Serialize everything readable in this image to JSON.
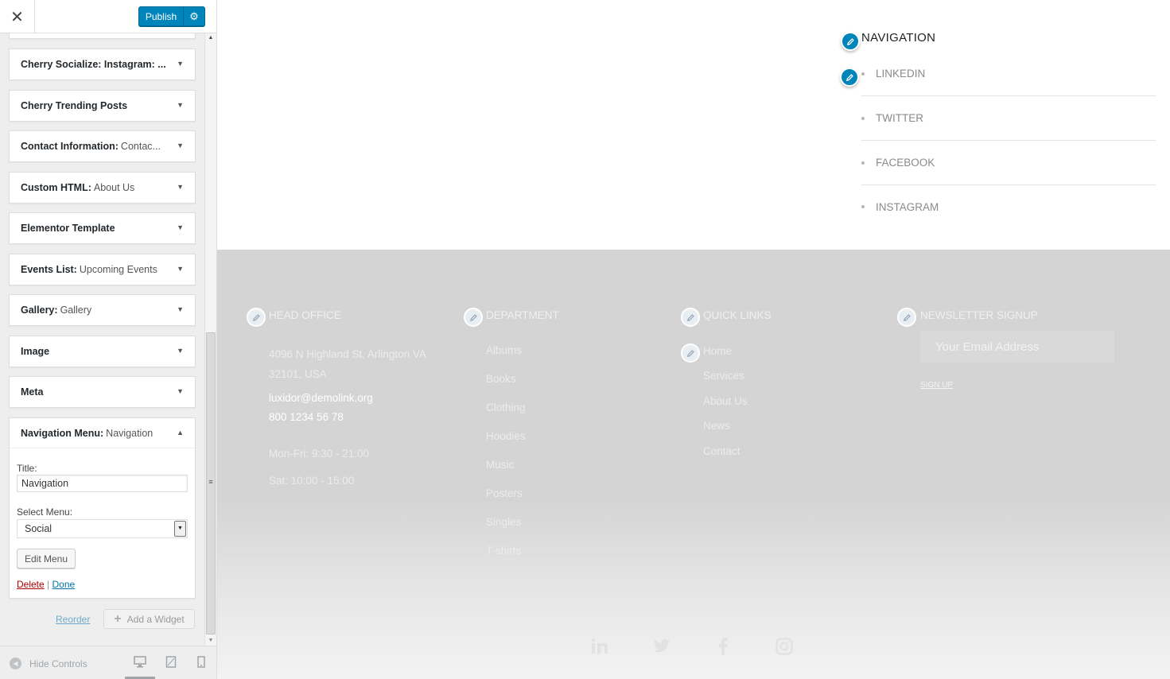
{
  "customizer": {
    "close_icon": "✕",
    "publish_label": "Publish",
    "settings_icon": "⚙",
    "widgets": [
      {
        "name": "Cherry Socialize: Instagram: ...",
        "sub": ""
      },
      {
        "name": "Cherry Trending Posts",
        "sub": ""
      },
      {
        "name": "Contact Information:",
        "sub": "Contac..."
      },
      {
        "name": "Custom HTML:",
        "sub": "About Us"
      },
      {
        "name": "Elementor Template",
        "sub": ""
      },
      {
        "name": "Events List:",
        "sub": "Upcoming Events"
      },
      {
        "name": "Gallery:",
        "sub": "Gallery"
      },
      {
        "name": "Image",
        "sub": ""
      },
      {
        "name": "Meta",
        "sub": ""
      }
    ],
    "open_widget": {
      "name": "Navigation Menu:",
      "sub": "Navigation",
      "title_label": "Title:",
      "title_value": "Navigation",
      "select_label": "Select Menu:",
      "select_value": "Social",
      "edit_menu_label": "Edit Menu",
      "delete_label": "Delete",
      "separator": "|",
      "done_label": "Done"
    },
    "reorder_label": "Reorder",
    "add_widget_label": "Add a Widget",
    "hide_controls_label": "Hide Controls"
  },
  "preview": {
    "nav_title": "NAVIGATION",
    "nav_items": [
      "LINKEDIN",
      "TWITTER",
      "FACEBOOK",
      "INSTAGRAM"
    ],
    "footer": {
      "head_office": {
        "title": "HEAD OFFICE",
        "address_line1": "4096 N Highland St, Arlington VA",
        "address_line2": "32101, USA",
        "email": "luxidor@demolink.org",
        "phone": "800 1234 56 78",
        "hours1": "Mon-Fri: 9:30 - 21:00",
        "hours2": "Sat: 10:00 - 15:00"
      },
      "department": {
        "title": "DEPARTMENT",
        "items": [
          "Albums",
          "Books",
          "Clothing",
          "Hoodies",
          "Music",
          "Posters",
          "Singles",
          "T-shirts"
        ]
      },
      "quick_links": {
        "title": "QUICK LINKS",
        "items": [
          "Home",
          "Services",
          "About Us",
          "News",
          "Contact"
        ]
      },
      "newsletter": {
        "title": "NEWSLETTER SIGNUP",
        "email_placeholder": "Your Email Address",
        "signup_label": "SIGN UP"
      },
      "social_icons": [
        "linkedin-icon",
        "twitter-icon",
        "facebook-icon",
        "instagram-icon"
      ]
    }
  },
  "colors": {
    "accent": "#0085ba",
    "delete": "#a00000",
    "footer_bg": "#d4d4d4"
  }
}
